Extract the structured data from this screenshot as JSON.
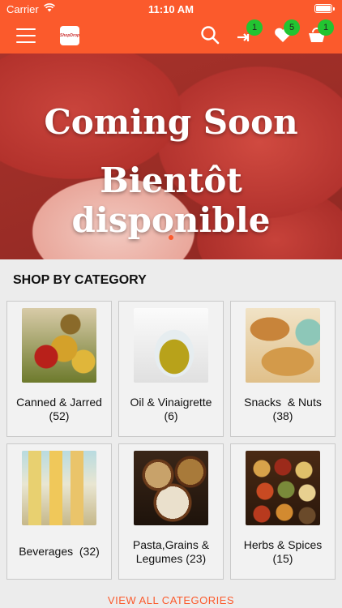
{
  "status_bar": {
    "carrier": "Carrier",
    "time": "11:10 AM"
  },
  "app_bar": {
    "logo_text": "ShopDrop",
    "badges": {
      "compare": "1",
      "wishlist": "5",
      "cart": "1"
    }
  },
  "banner": {
    "line1": "Coming Soon",
    "line2": "Bientôt disponible"
  },
  "section": {
    "title": "SHOP BY CATEGORY"
  },
  "categories": [
    {
      "name": "Canned & Jarred",
      "count": "(52)"
    },
    {
      "name": "Oil & Vinaigrette",
      "count": "(6)"
    },
    {
      "name": "Snacks  & Nuts",
      "count": "(38)"
    },
    {
      "name": "Beverages  (32)"
    },
    {
      "name": "Pasta,Grains &",
      "count": "Legumes (23)"
    },
    {
      "name": "Herbs & Spices",
      "count": "(15)"
    }
  ],
  "footer": {
    "view_all": "VIEW ALL CATEGORIES"
  },
  "colors": {
    "accent": "#fb5a2c",
    "badge": "#22c431"
  }
}
